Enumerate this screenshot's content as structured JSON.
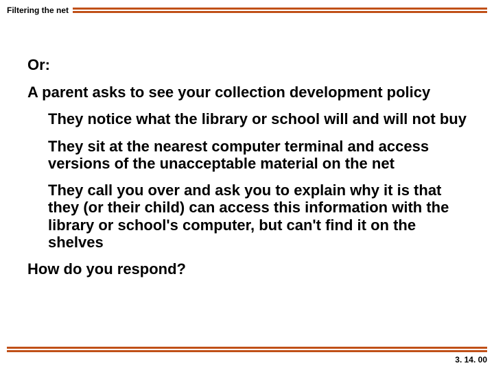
{
  "header": {
    "title": "Filtering the net"
  },
  "content": {
    "or": "Or:",
    "intro": "A parent asks to see your collection development policy",
    "bullets": [
      "They notice what the library or school will and will not buy",
      "They sit at the nearest computer terminal and access versions of the unacceptable material on the net",
      "They call you over and ask you to explain why it is that they (or their child) can access this information with the library or school's computer, but can't find it on the shelves"
    ],
    "question": "How do you respond?"
  },
  "footer": {
    "date": "3. 14. 00"
  }
}
